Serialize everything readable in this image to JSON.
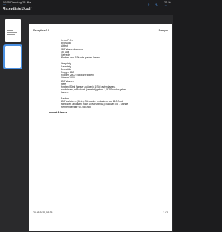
{
  "status": {
    "time": "09:55",
    "date": "Dienstag 28. Mai",
    "battery": "22 %"
  },
  "toolbar": {
    "doc_title": "Rezeptliste19.pdf"
  },
  "page": {
    "header_left": "Rezeptliste 19",
    "header_right": "Rezepte",
    "lines_1": [
      "in der Früh:",
      "Brotstück",
      "Altbrot",
      "180 Wasser kochend",
      "15 Salz",
      "Getreide",
      "Machen und 1 Stunde quellen lassen."
    ],
    "lines_2": [
      "Hauptteig",
      "Sauerteig",
      "Brotstück",
      "Roggen 880",
      "Roggen 2500 (Schwarzroggen)",
      "Weizen 1600",
      "250 Wasser",
      "Hefe",
      "Kneten (50ml Wasser zufügen). 1 Std rasten lassen,",
      "rundwirken, in Brotkorb (bemehlt) geben. 1,5-2 Stunden gehen",
      "lassen."
    ],
    "lines_3": [
      "Backen:",
      "250 Vorheizen (Stein). Schwaden, reduzieren auf 210 Grad,",
      "schwaden ablassen (nach 10 Minuten ca). Backzeit ca 1 Stunde",
      "Kerntemperatur: 97-98 Grad"
    ],
    "internet_label": "Internet Adresse",
    "footer_left": "28.05.2024, 09:35",
    "footer_right": "2 / 2"
  }
}
